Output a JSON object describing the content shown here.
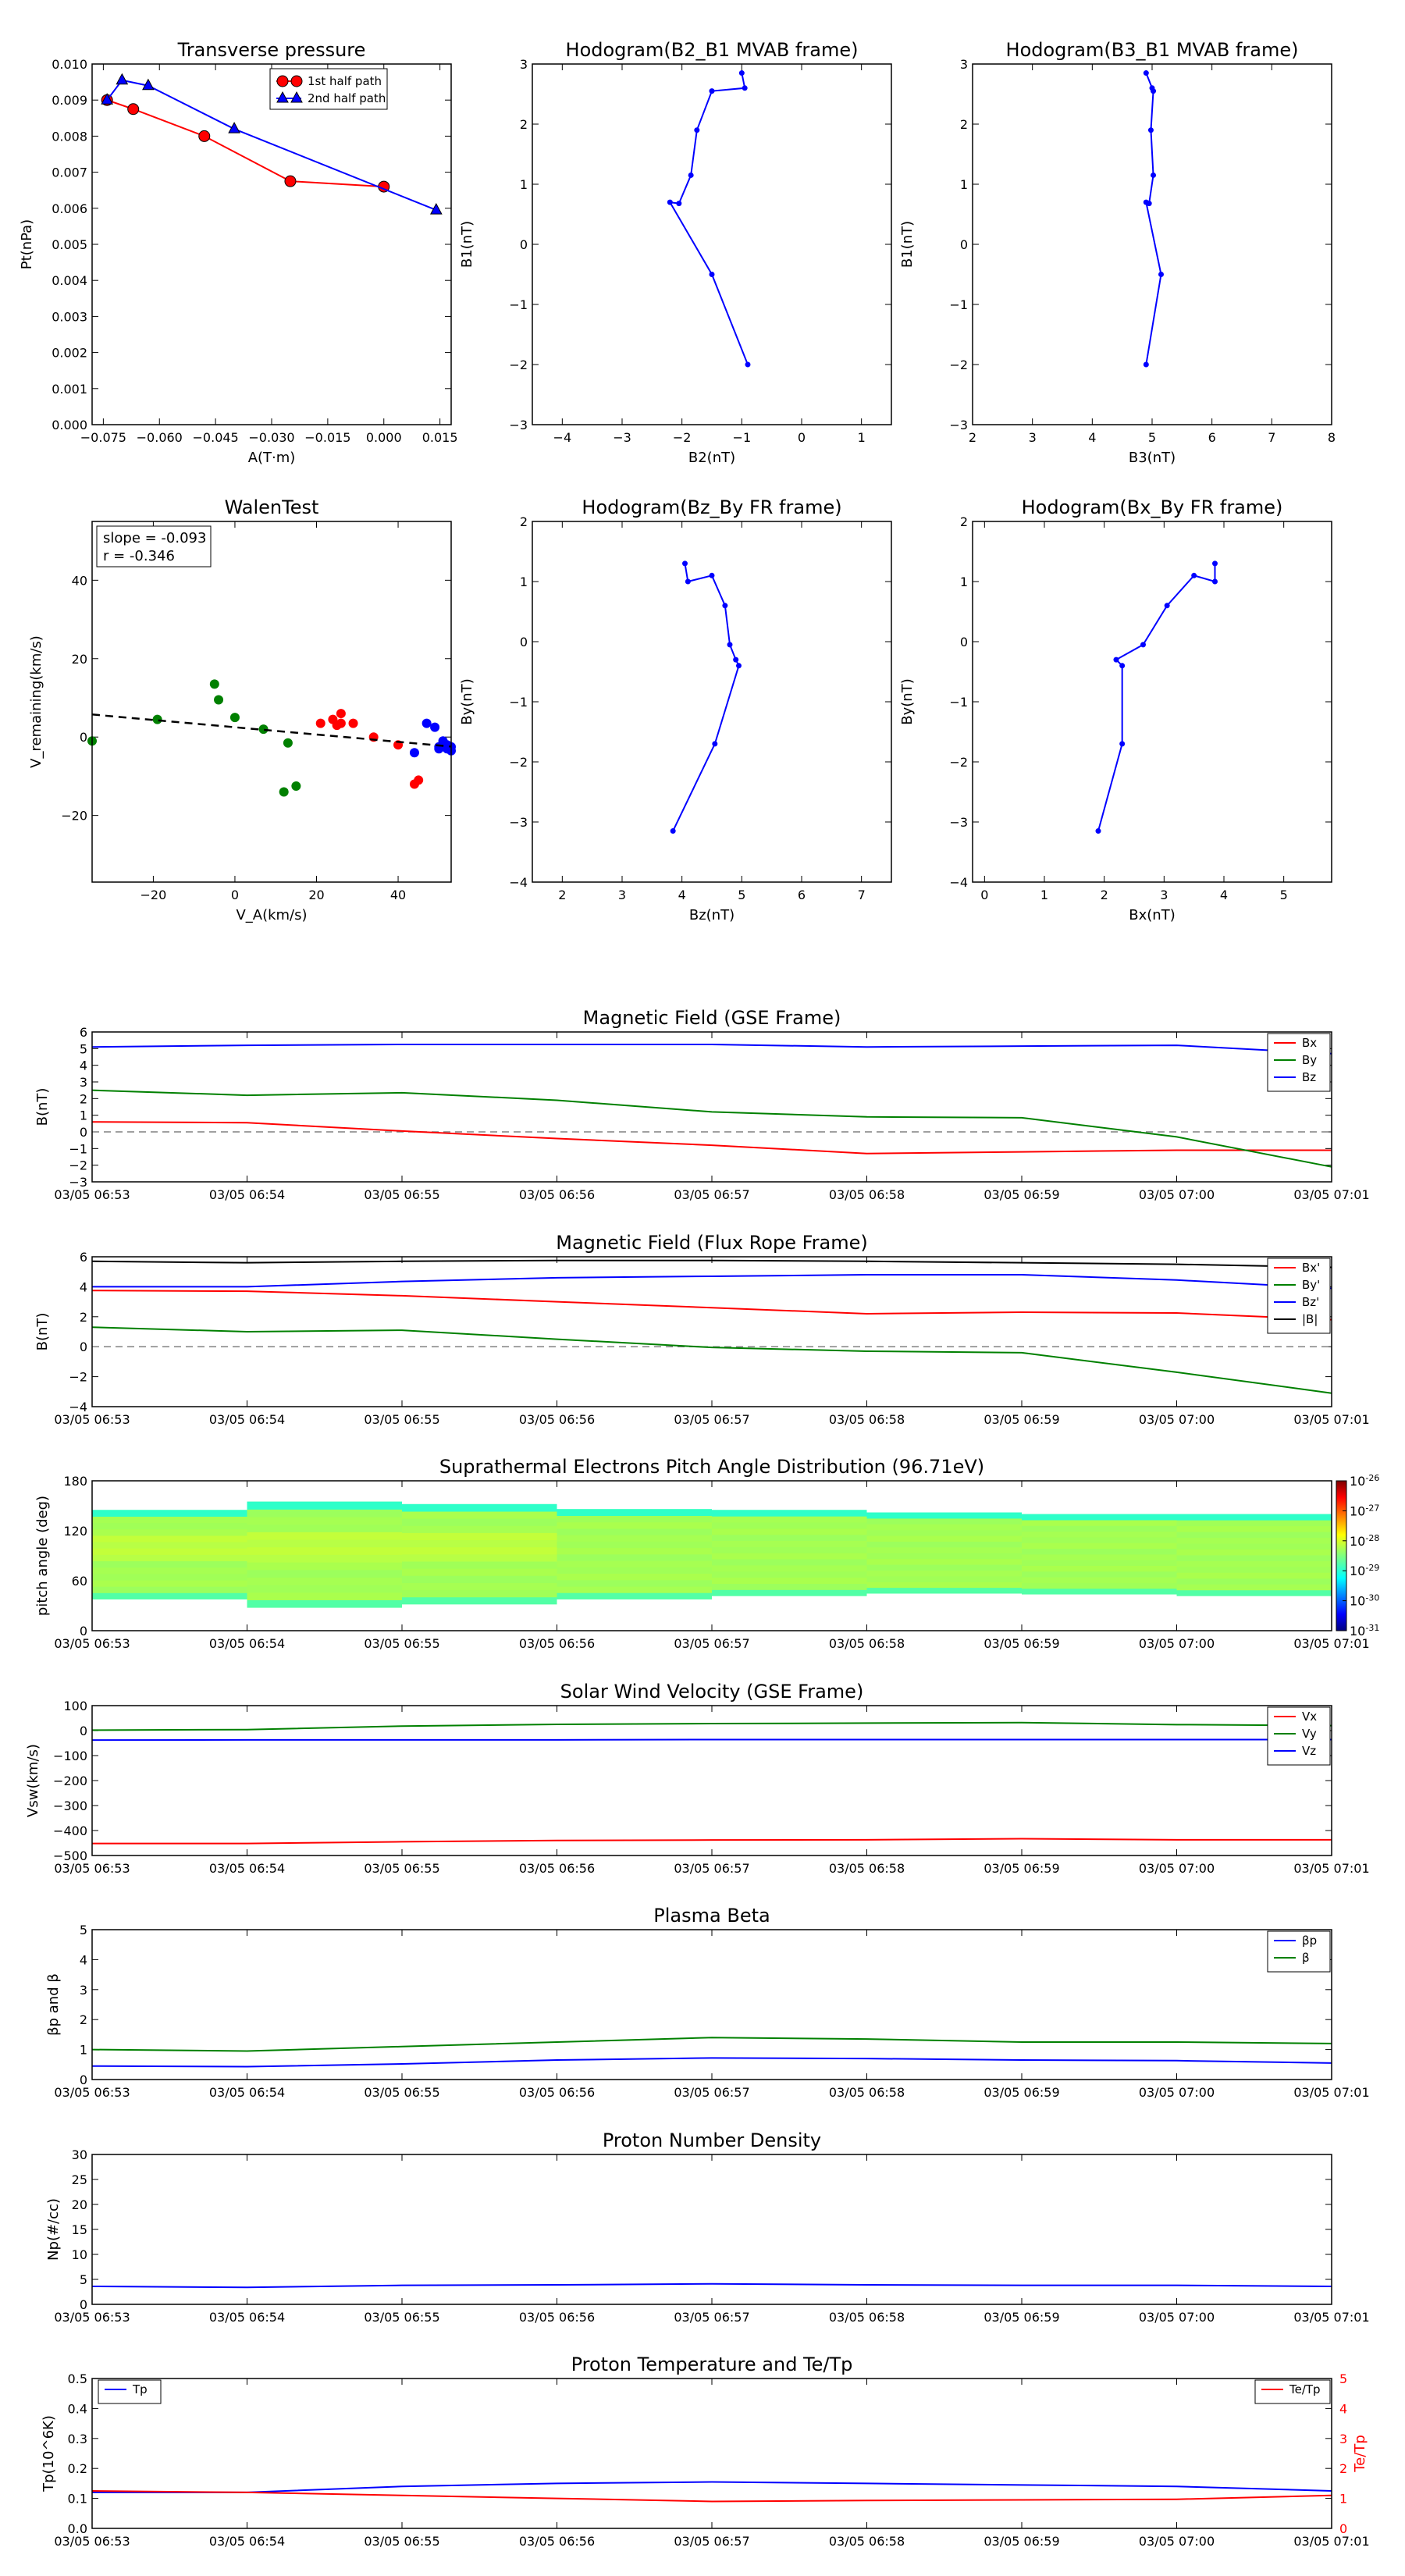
{
  "time_ticks": [
    "03/05 06:53",
    "03/05 06:54",
    "03/05 06:55",
    "03/05 06:56",
    "03/05 06:57",
    "03/05 06:58",
    "03/05 06:59",
    "03/05 07:00",
    "03/05 07:01"
  ],
  "colors": {
    "red": "#ff0000",
    "green": "#008000",
    "blue": "#0000ff",
    "black": "#000000",
    "gray": "#808080"
  },
  "chart_data": [
    {
      "id": "tp",
      "type": "line",
      "title": "Transverse pressure",
      "xlabel": "A(T·m)",
      "ylabel": "Pt(nPa)",
      "xlim": [
        -0.078,
        0.018
      ],
      "ylim": [
        0,
        0.01
      ],
      "xticks": [
        -0.075,
        -0.06,
        -0.045,
        -0.03,
        -0.015,
        0.0,
        0.015
      ],
      "xtick_labels": [
        "−0.075",
        "−0.060",
        "−0.045",
        "−0.030",
        "−0.015",
        "0.000",
        "0.015"
      ],
      "yticks": [
        0,
        0.001,
        0.002,
        0.003,
        0.004,
        0.005,
        0.006,
        0.007,
        0.008,
        0.009,
        0.01
      ],
      "ytick_labels": [
        "0.000",
        "0.001",
        "0.002",
        "0.003",
        "0.004",
        "0.005",
        "0.006",
        "0.007",
        "0.008",
        "0.009",
        "0.010"
      ],
      "legend": "top-center",
      "series": [
        {
          "name": "1st half path",
          "color": "red",
          "marker": "circle",
          "x": [
            0.0,
            -0.025,
            -0.048,
            -0.067,
            -0.074
          ],
          "y": [
            0.0066,
            0.00675,
            0.008,
            0.00875,
            0.009
          ]
        },
        {
          "name": "2nd half path",
          "color": "blue",
          "marker": "triangle",
          "x": [
            -0.074,
            -0.07,
            -0.063,
            -0.04,
            0.014
          ],
          "y": [
            0.009,
            0.00955,
            0.0094,
            0.0082,
            0.00595
          ]
        }
      ]
    },
    {
      "id": "hodo1",
      "type": "line",
      "title": "Hodogram(B2_B1 MVAB frame)",
      "xlabel": "B2(nT)",
      "ylabel": "B1(nT)",
      "xlim": [
        -4.5,
        1.5
      ],
      "ylim": [
        -3,
        3
      ],
      "xticks": [
        -4,
        -3,
        -2,
        -1,
        0,
        1
      ],
      "xtick_labels": [
        "−4",
        "−3",
        "−2",
        "−1",
        "0",
        "1"
      ],
      "yticks": [
        -3,
        -2,
        -1,
        0,
        1,
        2,
        3
      ],
      "ytick_labels": [
        "−3",
        "−2",
        "−1",
        "0",
        "1",
        "2",
        "3"
      ],
      "series": [
        {
          "color": "blue",
          "marker": "dot",
          "x": [
            -0.9,
            -1.5,
            -2.2,
            -2.05,
            -1.85,
            -1.75,
            -1.5,
            -0.95,
            -1.0
          ],
          "y": [
            -2.0,
            -0.5,
            0.7,
            0.68,
            1.15,
            1.9,
            2.55,
            2.6,
            2.85
          ]
        }
      ]
    },
    {
      "id": "hodo2",
      "type": "line",
      "title": "Hodogram(B3_B1 MVAB frame)",
      "xlabel": "B3(nT)",
      "ylabel": "B1(nT)",
      "xlim": [
        2,
        8
      ],
      "ylim": [
        -3,
        3
      ],
      "xticks": [
        2,
        3,
        4,
        5,
        6,
        7,
        8
      ],
      "xtick_labels": [
        "2",
        "3",
        "4",
        "5",
        "6",
        "7",
        "8"
      ],
      "yticks": [
        -3,
        -2,
        -1,
        0,
        1,
        2,
        3
      ],
      "ytick_labels": [
        "−3",
        "−2",
        "−1",
        "0",
        "1",
        "2",
        "3"
      ],
      "series": [
        {
          "color": "blue",
          "marker": "dot",
          "x": [
            4.9,
            5.15,
            4.9,
            4.95,
            5.02,
            4.98,
            5.02,
            5.0,
            4.9
          ],
          "y": [
            -2.0,
            -0.5,
            0.7,
            0.68,
            1.15,
            1.9,
            2.55,
            2.6,
            2.85
          ]
        }
      ]
    },
    {
      "id": "walen",
      "type": "scatter",
      "title": "WalenTest",
      "xlabel": "V_A(km/s)",
      "ylabel": "V_remaining(km/s)",
      "xlim": [
        -35,
        53
      ],
      "ylim": [
        -37,
        55
      ],
      "xticks": [
        -20,
        0,
        20,
        40
      ],
      "xtick_labels": [
        "−20",
        "0",
        "20",
        "40"
      ],
      "yticks": [
        -20,
        0,
        20,
        40
      ],
      "ytick_labels": [
        "−20",
        "0",
        "20",
        "40"
      ],
      "annotation": {
        "slope": "slope = -0.093",
        "r": "r = -0.346"
      },
      "fit": {
        "slope": -0.093,
        "intercept": 2.5
      },
      "groups": [
        {
          "color": "green",
          "x": [
            -35,
            -19,
            -5,
            -4,
            0,
            7,
            12,
            13,
            15
          ],
          "y": [
            -1,
            4.5,
            13.5,
            9.5,
            5,
            2,
            -14,
            -1.5,
            -12.5
          ]
        },
        {
          "color": "red",
          "x": [
            21,
            24,
            25,
            26,
            26,
            29,
            34,
            40,
            44,
            45
          ],
          "y": [
            3.5,
            4.5,
            3,
            6,
            3.5,
            3.5,
            0,
            -2,
            -12,
            -11
          ]
        },
        {
          "color": "blue",
          "x": [
            44,
            47,
            49,
            50,
            51,
            52,
            52,
            53,
            53,
            50
          ],
          "y": [
            -4,
            3.5,
            2.5,
            -3,
            -1,
            -2,
            -3,
            -2.5,
            -3.5,
            -2.5
          ]
        }
      ]
    },
    {
      "id": "hodo3",
      "type": "line",
      "title": "Hodogram(Bz_By FR frame)",
      "xlabel": "Bz(nT)",
      "ylabel": "By(nT)",
      "xlim": [
        1.5,
        7.5
      ],
      "ylim": [
        -4,
        2
      ],
      "xticks": [
        2,
        3,
        4,
        5,
        6,
        7
      ],
      "xtick_labels": [
        "2",
        "3",
        "4",
        "5",
        "6",
        "7"
      ],
      "yticks": [
        -4,
        -3,
        -2,
        -1,
        0,
        1,
        2
      ],
      "ytick_labels": [
        "−4",
        "−3",
        "−2",
        "−1",
        "0",
        "1",
        "2"
      ],
      "series": [
        {
          "color": "blue",
          "marker": "dot",
          "x": [
            3.85,
            4.55,
            4.95,
            4.9,
            4.8,
            4.72,
            4.5,
            4.1,
            4.05
          ],
          "y": [
            -3.15,
            -1.7,
            -0.4,
            -0.3,
            -0.05,
            0.6,
            1.1,
            1.0,
            1.3
          ]
        }
      ]
    },
    {
      "id": "hodo4",
      "type": "line",
      "title": "Hodogram(Bx_By FR frame)",
      "xlabel": "Bx(nT)",
      "ylabel": "By(nT)",
      "xlim": [
        -0.2,
        5.8
      ],
      "ylim": [
        -4,
        2
      ],
      "xticks": [
        0,
        1,
        2,
        3,
        4,
        5
      ],
      "xtick_labels": [
        "0",
        "1",
        "2",
        "3",
        "4",
        "5"
      ],
      "yticks": [
        -4,
        -3,
        -2,
        -1,
        0,
        1,
        2
      ],
      "ytick_labels": [
        "−4",
        "−3",
        "−2",
        "−1",
        "0",
        "1",
        "2"
      ],
      "series": [
        {
          "color": "blue",
          "marker": "dot",
          "x": [
            1.9,
            2.3,
            2.3,
            2.2,
            2.65,
            3.05,
            3.5,
            3.85,
            3.85
          ],
          "y": [
            -3.15,
            -1.7,
            -0.4,
            -0.3,
            -0.05,
            0.6,
            1.1,
            1.0,
            1.3
          ]
        }
      ]
    },
    {
      "id": "mag_gse",
      "type": "line",
      "title": "Magnetic Field (GSE Frame)",
      "ylabel": "B(nT)",
      "ylim": [
        -3,
        6
      ],
      "yticks": [
        -3,
        -2,
        -1,
        0,
        1,
        2,
        3,
        4,
        5,
        6
      ],
      "ytick_labels": [
        "−3",
        "−2",
        "−1",
        "0",
        "1",
        "2",
        "3",
        "4",
        "5",
        "6"
      ],
      "zero_line": true,
      "legend": "top-right",
      "series": [
        {
          "name": "Bx",
          "color": "red",
          "values": [
            0.6,
            0.55,
            0.05,
            -0.4,
            -0.8,
            -1.3,
            -1.2,
            -1.1,
            -1.1
          ]
        },
        {
          "name": "By",
          "color": "green",
          "values": [
            2.5,
            2.2,
            2.35,
            1.9,
            1.2,
            0.9,
            0.85,
            -0.3,
            -2.1
          ]
        },
        {
          "name": "Bz",
          "color": "blue",
          "values": [
            5.1,
            5.2,
            5.25,
            5.25,
            5.25,
            5.1,
            5.15,
            5.2,
            4.7
          ]
        }
      ]
    },
    {
      "id": "mag_fr",
      "type": "line",
      "title": "Magnetic Field (Flux Rope Frame)",
      "ylabel": "B(nT)",
      "ylim": [
        -4,
        6
      ],
      "yticks": [
        -4,
        -2,
        0,
        2,
        4,
        6
      ],
      "ytick_labels": [
        "−4",
        "−2",
        "0",
        "2",
        "4",
        "6"
      ],
      "zero_line": true,
      "legend": "top-right",
      "series": [
        {
          "name": "Bx'",
          "color": "red",
          "values": [
            3.75,
            3.7,
            3.4,
            3.0,
            2.6,
            2.2,
            2.3,
            2.25,
            1.8
          ]
        },
        {
          "name": "By'",
          "color": "green",
          "values": [
            1.3,
            1.0,
            1.1,
            0.5,
            -0.05,
            -0.3,
            -0.4,
            -1.7,
            -3.1
          ]
        },
        {
          "name": "Bz'",
          "color": "blue",
          "values": [
            4.0,
            4.0,
            4.35,
            4.6,
            4.7,
            4.8,
            4.8,
            4.45,
            3.9
          ]
        },
        {
          "name": "|B|",
          "color": "black",
          "values": [
            5.7,
            5.6,
            5.7,
            5.75,
            5.75,
            5.7,
            5.6,
            5.5,
            5.3
          ]
        }
      ]
    },
    {
      "id": "pad",
      "type": "heatmap",
      "title": "Suprathermal Electrons Pitch Angle Distribution (96.71eV)",
      "ylabel": "pitch angle (deg)",
      "ylim": [
        0,
        180
      ],
      "yticks": [
        0,
        60,
        120,
        180
      ],
      "ytick_labels": [
        "0",
        "60",
        "120",
        "180"
      ],
      "colorbar_ticks": [
        "10^-26",
        "10^-27",
        "10^-28",
        "10^-29",
        "10^-30",
        "10^-31"
      ],
      "colorbar_exps": [
        "-26",
        "-27",
        "-28",
        "-29",
        "-30",
        "-31"
      ],
      "columns": [
        {
          "lo": 38,
          "hi": 145
        },
        {
          "lo": 28,
          "hi": 155
        },
        {
          "lo": 32,
          "hi": 152
        },
        {
          "lo": 38,
          "hi": 146
        },
        {
          "lo": 42,
          "hi": 145
        },
        {
          "lo": 45,
          "hi": 142
        },
        {
          "lo": 44,
          "hi": 140
        },
        {
          "lo": 42,
          "hi": 140
        }
      ]
    },
    {
      "id": "vsw",
      "type": "line",
      "title": "Solar Wind Velocity (GSE Frame)",
      "ylabel": "Vsw(km/s)",
      "ylim": [
        -500,
        100
      ],
      "yticks": [
        -500,
        -400,
        -300,
        -200,
        -100,
        0,
        100
      ],
      "ytick_labels": [
        "−500",
        "−400",
        "−300",
        "−200",
        "−100",
        "0",
        "100"
      ],
      "legend": "top-right",
      "series": [
        {
          "name": "Vx",
          "color": "red",
          "values": [
            -452,
            -452,
            -445,
            -440,
            -438,
            -437,
            -433,
            -437,
            -437
          ]
        },
        {
          "name": "Vy",
          "color": "green",
          "values": [
            2,
            4,
            18,
            25,
            28,
            30,
            32,
            24,
            20
          ]
        },
        {
          "name": "Vz",
          "color": "blue",
          "values": [
            -38,
            -37,
            -37,
            -37,
            -36,
            -36,
            -36,
            -36,
            -36
          ]
        }
      ]
    },
    {
      "id": "beta",
      "type": "line",
      "title": "Plasma Beta",
      "ylabel": "βp and β",
      "ylim": [
        0,
        5
      ],
      "yticks": [
        0,
        1,
        2,
        3,
        4,
        5
      ],
      "ytick_labels": [
        "0",
        "1",
        "2",
        "3",
        "4",
        "5"
      ],
      "legend": "top-right",
      "series": [
        {
          "name": "βp",
          "color": "blue",
          "values": [
            0.45,
            0.43,
            0.52,
            0.65,
            0.72,
            0.7,
            0.65,
            0.63,
            0.55
          ]
        },
        {
          "name": "β",
          "color": "green",
          "values": [
            1.0,
            0.95,
            1.1,
            1.25,
            1.4,
            1.35,
            1.25,
            1.25,
            1.2
          ]
        }
      ]
    },
    {
      "id": "np",
      "type": "line",
      "title": "Proton Number Density",
      "ylabel": "Np(#/cc)",
      "ylim": [
        0,
        30
      ],
      "yticks": [
        0,
        5,
        10,
        15,
        20,
        25,
        30
      ],
      "ytick_labels": [
        "0",
        "5",
        "10",
        "15",
        "20",
        "25",
        "30"
      ],
      "series": [
        {
          "color": "blue",
          "values": [
            3.6,
            3.4,
            3.8,
            3.9,
            4.1,
            3.9,
            3.8,
            3.8,
            3.6
          ]
        }
      ]
    },
    {
      "id": "tpk",
      "type": "line",
      "title": "Proton Temperature and Te/Tp",
      "ylabel": "Tp(10^6K)",
      "ylabel_right": "Te/Tp",
      "ylim": [
        0,
        0.5
      ],
      "yticks": [
        0,
        0.1,
        0.2,
        0.3,
        0.4,
        0.5
      ],
      "ytick_labels": [
        "0.0",
        "0.1",
        "0.2",
        "0.3",
        "0.4",
        "0.5"
      ],
      "ylim_right": [
        0,
        5
      ],
      "yticks_right": [
        0,
        1,
        2,
        3,
        4,
        5
      ],
      "ytick_labels_right": [
        "0",
        "1",
        "2",
        "3",
        "4",
        "5"
      ],
      "series": [
        {
          "name": "Tp",
          "color": "blue",
          "values": [
            0.12,
            0.12,
            0.14,
            0.15,
            0.155,
            0.15,
            0.145,
            0.14,
            0.125
          ],
          "axis": "left",
          "legend": "top-left"
        },
        {
          "name": "Te/Tp",
          "color": "red",
          "values": [
            1.25,
            1.2,
            1.1,
            1.0,
            0.9,
            0.93,
            0.95,
            0.97,
            1.1
          ],
          "axis": "right",
          "legend": "top-right"
        }
      ]
    }
  ]
}
